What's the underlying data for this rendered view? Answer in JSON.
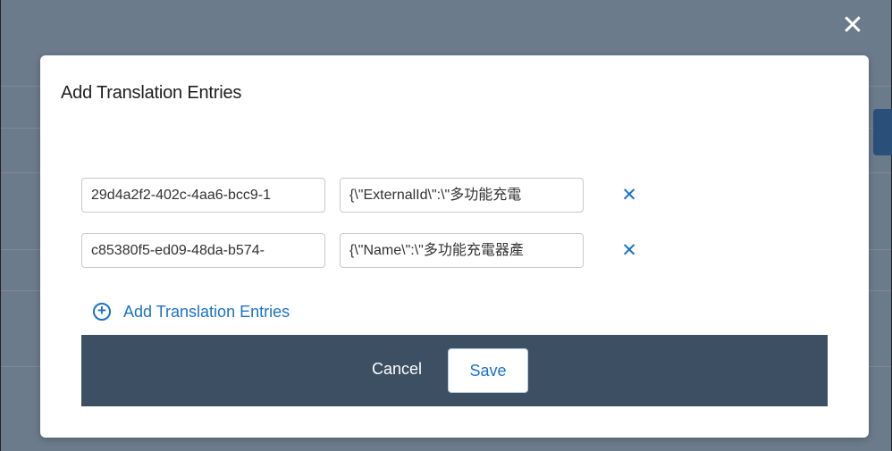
{
  "overlay": {
    "close_icon": "close-icon",
    "close_glyph": "✕"
  },
  "dialog": {
    "title": "Add Translation Entries",
    "entries": [
      {
        "key": "29d4a2f2-402c-4aa6-bcc9-1",
        "value": "{\\\"ExternalId\\\":\\\"多功能充電"
      },
      {
        "key": "c85380f5-ed09-48da-b574-",
        "value": "{\\\"Name\\\":\\\"多功能充電器產"
      }
    ],
    "remove_glyph": "✕",
    "add_link_label": "Add Translation Entries",
    "add_glyph": "+",
    "cancel_label": "Cancel",
    "save_label": "Save"
  },
  "colors": {
    "accent": "#1a73c9",
    "footer": "#3d4f62",
    "backdrop": "#6c7b8b"
  }
}
